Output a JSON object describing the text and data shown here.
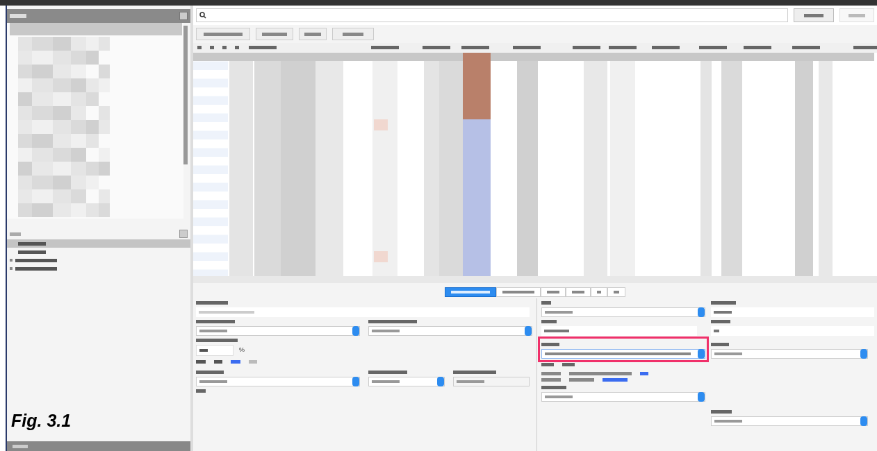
{
  "caption": "Fig. 3.1",
  "tree_items": [
    {
      "selected": true,
      "kind": "leaf"
    },
    {
      "selected": false,
      "kind": "leaf"
    },
    {
      "selected": false,
      "kind": "branch"
    },
    {
      "selected": false,
      "kind": "branch"
    }
  ],
  "detail_tabs": [
    {
      "selected": true
    },
    {
      "selected": false
    },
    {
      "selected": false
    },
    {
      "selected": false
    },
    {
      "selected": false
    },
    {
      "selected": false
    }
  ],
  "form": {
    "percent_unit": "%",
    "highlighted_field": true
  }
}
